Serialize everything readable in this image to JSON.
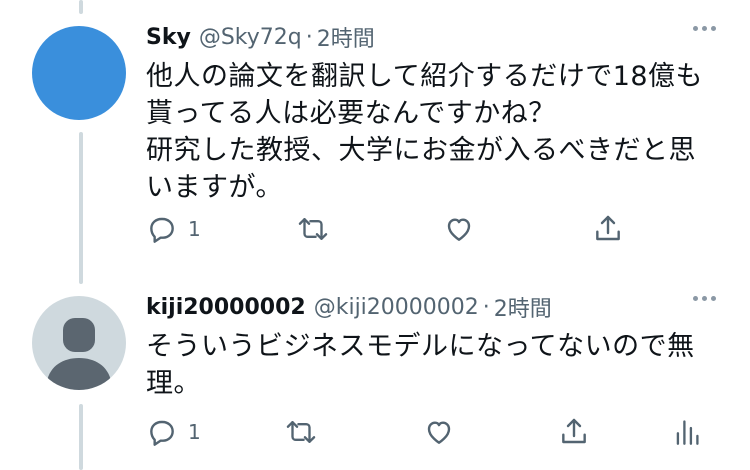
{
  "tweets": [
    {
      "name": "Sky",
      "handle": "@Sky72q",
      "separator": "·",
      "time": "2時間",
      "text": "他人の論文を翻訳して紹介するだけで18億も\n貰ってる人は必要なんですかね？\n研究した教授、大学にお金が入るべきだと思\nいますが。",
      "reply_count": "1",
      "avatar_color": "#3a8fdc"
    },
    {
      "name": "kiji20000002",
      "handle": "@kiji20000002",
      "separator": "·",
      "time": "2時間",
      "text": "そういうビジネスモデルになってないので無\n理。",
      "reply_count": "1",
      "avatar_color": "#cfd9de"
    }
  ],
  "icons": {
    "reply": "reply-icon",
    "retweet": "retweet-icon",
    "like": "like-icon",
    "share": "share-icon",
    "analytics": "analytics-icon",
    "more": "more-icon"
  },
  "colors": {
    "text": "#0f1419",
    "secondary": "#536471",
    "thread_line": "#cfd9de"
  }
}
